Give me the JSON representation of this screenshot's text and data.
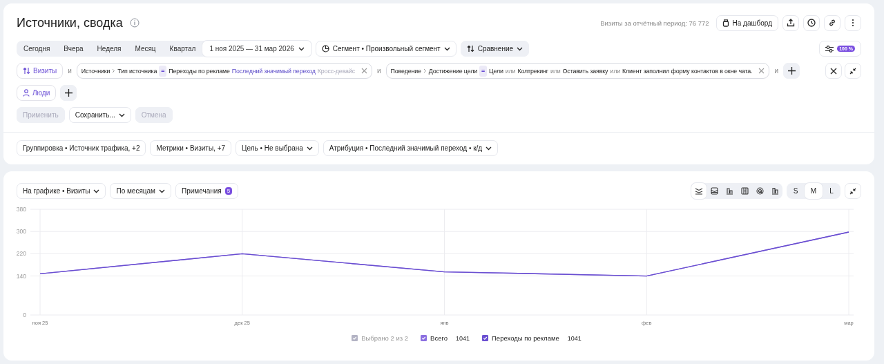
{
  "header": {
    "title": "Источники, сводка",
    "visits_total": "Визиты за отчётный период: 76 772",
    "dashboard_button": "На дашборд"
  },
  "period_tabs": [
    {
      "label": "Сегодня",
      "selected": false
    },
    {
      "label": "Вчера",
      "selected": false
    },
    {
      "label": "Неделя",
      "selected": false
    },
    {
      "label": "Месяц",
      "selected": false
    },
    {
      "label": "Квартал",
      "selected": false
    },
    {
      "label": "1 ноя 2025 — 31 мар 2026",
      "selected": true,
      "kind": "range"
    }
  ],
  "segment": "Сегмент • Произвольный сегмент",
  "comparison": "Сравнение",
  "sampling": "100 %",
  "filters": [
    {
      "kind": "metric",
      "label": "Визиты"
    },
    {
      "kind": "and",
      "label": "и"
    },
    {
      "kind": "condition",
      "path": [
        "Источники",
        "Тип источника"
      ],
      "operator": "=",
      "values": [
        {
          "text": "Переходы по рекламе"
        }
      ],
      "attribution": "Последний значимый переход",
      "mode": "Кросс-девайс"
    },
    {
      "kind": "and",
      "label": "и"
    },
    {
      "kind": "condition",
      "path": [
        "Поведение",
        "Достижение цели"
      ],
      "operator": "=",
      "values": [
        {
          "text": "Цели"
        },
        {
          "joiner": "или",
          "text": "Колтрекинг"
        },
        {
          "joiner": "или",
          "text": "Оставить заявку"
        },
        {
          "joiner": "или",
          "text": "Клиент заполнил форму контактов в окне чата."
        }
      ]
    },
    {
      "kind": "and",
      "label": "и"
    },
    {
      "kind": "add"
    }
  ],
  "people_filter": "Люди",
  "actions": [
    {
      "label": "Применить",
      "disabled": true,
      "kind": "button"
    },
    {
      "label": "Сохранить...",
      "disabled": false,
      "kind": "dropdown"
    },
    {
      "label": "Отмена",
      "disabled": true,
      "kind": "button"
    }
  ],
  "settings": [
    {
      "label": "Группировка • Источник трафика, +2",
      "dropdown": false
    },
    {
      "label": "Метрики • Визиты, +7",
      "dropdown": false
    },
    {
      "label": "Цель • Не выбрана",
      "dropdown": true
    },
    {
      "label": "Атрибуция • Последний значимый переход • к/д",
      "dropdown": true
    }
  ],
  "chart_toolbar": {
    "metric": "На графике • Визиты",
    "period": "По месяцам",
    "notes": "Примечания",
    "notes_count": "5",
    "chart_types": [
      {
        "kind": "lines",
        "selected": true
      },
      {
        "kind": "stacked",
        "selected": false
      },
      {
        "kind": "bars",
        "selected": false
      },
      {
        "kind": "table",
        "selected": false
      },
      {
        "kind": "donut",
        "selected": false
      },
      {
        "kind": "columns",
        "selected": false
      }
    ],
    "sizes": [
      {
        "label": "S",
        "selected": false
      },
      {
        "label": "M",
        "selected": true
      },
      {
        "label": "L",
        "selected": false
      }
    ]
  },
  "chart_data": {
    "type": "line",
    "categories": [
      "ноя 25",
      "дек 25",
      "янв",
      "фев",
      "мар"
    ],
    "ylim": [
      0,
      380
    ],
    "yticks": [
      0,
      140,
      220,
      300,
      380
    ],
    "grid": true,
    "series": [
      {
        "name": "Всего",
        "color": "#8b6fe0",
        "values": [
          148,
          220,
          155,
          140,
          298
        ]
      },
      {
        "name": "Переходы по рекламе",
        "color": "#6a4fd1",
        "values": [
          148,
          220,
          155,
          140,
          298
        ]
      }
    ]
  },
  "legend": {
    "summary": "Выбрано 2 из 2",
    "summary_checked": true,
    "items": [
      {
        "total": "1041",
        "checked": true
      },
      {
        "total": "1041",
        "checked": true
      }
    ]
  }
}
